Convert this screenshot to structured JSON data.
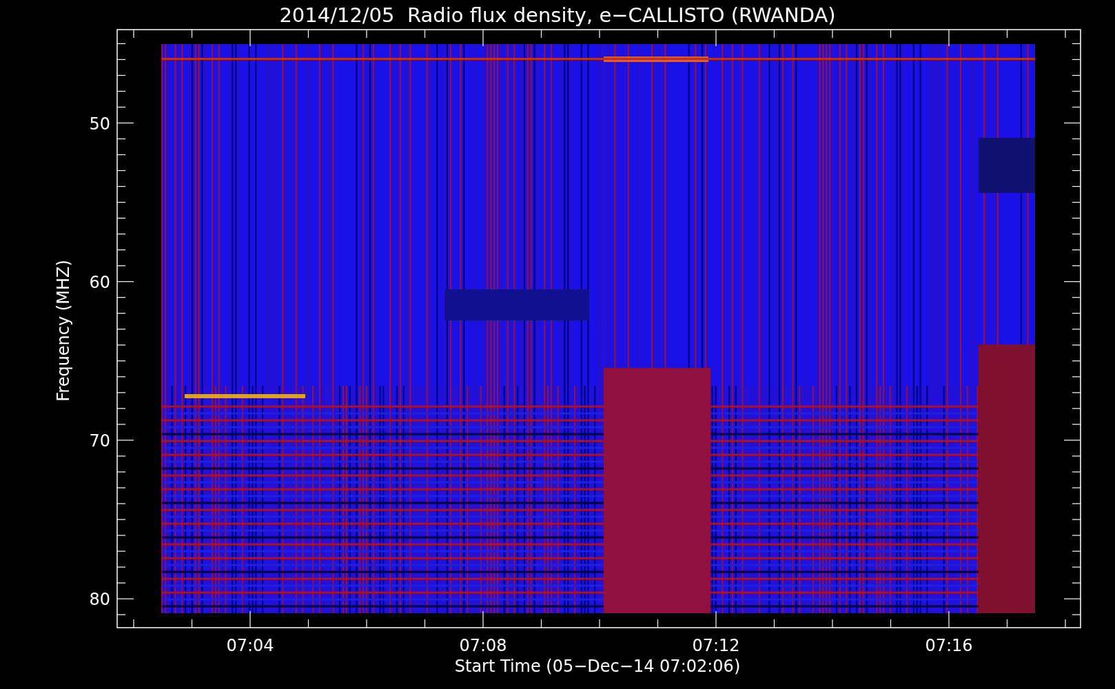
{
  "title": "2014/12/05  Radio flux density, e−CALLISTO (RWANDA)",
  "y_axis": {
    "label": "Frequency (MHZ)",
    "ticks": [
      {
        "label": "50"
      },
      {
        "label": "60"
      },
      {
        "label": "70"
      },
      {
        "label": "80"
      }
    ]
  },
  "x_axis": {
    "label": "Start Time (05−Dec−14 07:02:06)",
    "ticks": [
      {
        "label": "07:04"
      },
      {
        "label": "07:08"
      },
      {
        "label": "07:12"
      },
      {
        "label": "07:16"
      }
    ]
  }
}
